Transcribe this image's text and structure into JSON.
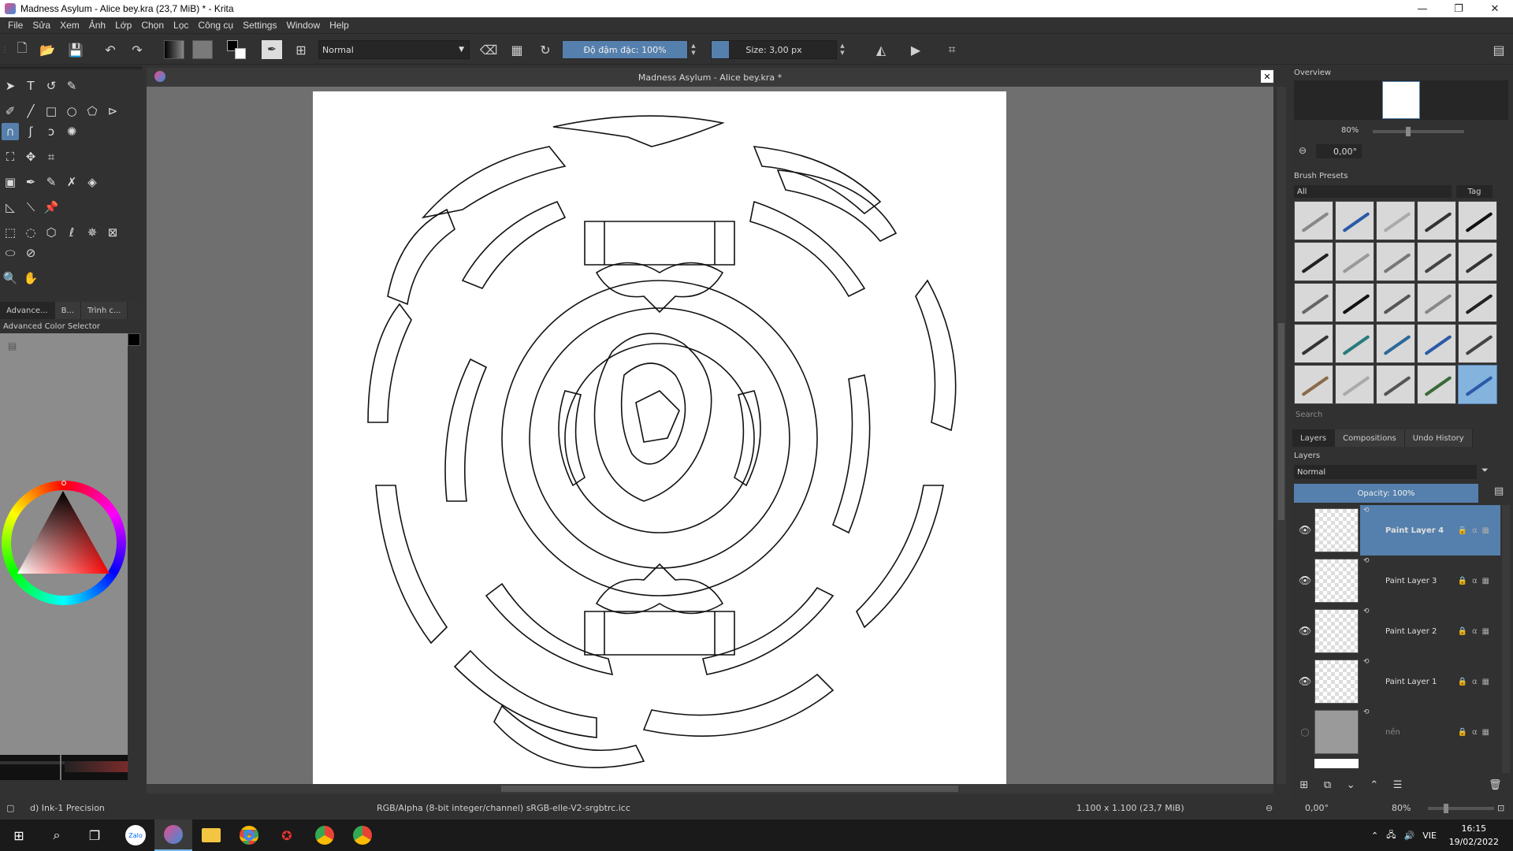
{
  "window": {
    "title": "Madness Asylum - Alice bey.kra (23,7 MiB)  * - Krita",
    "minimize": "—",
    "maximize": "❐",
    "close": "✕"
  },
  "menu": [
    "File",
    "Sửa",
    "Xem",
    "Ảnh",
    "Lớp",
    "Chọn",
    "Lọc",
    "Công cụ",
    "Settings",
    "Window",
    "Help"
  ],
  "toolbar": {
    "blend_mode": "Normal",
    "opacity_label": "Độ đậm đặc: 100%",
    "size_label": "Size: 3,00 px"
  },
  "left_dock": {
    "tabs": [
      "Advance...",
      "B...",
      "Trình c..."
    ],
    "color_selector_title": "Advanced Color Selector",
    "fg_color": "#000000"
  },
  "canvas": {
    "title": "Madness Asylum - Alice bey.kra *",
    "close": "✕"
  },
  "overview": {
    "title": "Overview",
    "zoom": "80%",
    "rotation": "0,00°"
  },
  "brush_presets": {
    "title": "Brush Presets",
    "filter": "All",
    "tag_label": "Tag",
    "search_placeholder": "Search",
    "selected_index": 24
  },
  "layers_docker": {
    "tabs": [
      "Layers",
      "Compositions",
      "Undo History"
    ],
    "title": "Layers",
    "blend_mode": "Normal",
    "opacity_label": "Opacity:  100%",
    "layers": [
      {
        "name": "Paint Layer 4",
        "visible": true,
        "selected": true
      },
      {
        "name": "Paint Layer 3",
        "visible": true,
        "selected": false
      },
      {
        "name": "Paint Layer 2",
        "visible": true,
        "selected": false
      },
      {
        "name": "Paint Layer 1",
        "visible": true,
        "selected": false
      },
      {
        "name": "nền",
        "visible": false,
        "selected": false
      }
    ]
  },
  "status": {
    "brush": "d) Ink-1 Precision",
    "color_space": "RGB/Alpha (8-bit integer/channel)  sRGB-elle-V2-srgbtrc.icc",
    "dimensions": "1.100 x 1.100 (23,7 MiB)",
    "rotation": "0,00°",
    "zoom": "80%"
  },
  "taskbar": {
    "language": "VIE",
    "time": "16:15",
    "date": "19/02/2022"
  },
  "colors": {
    "accent": "#5580ad",
    "panel": "#313131",
    "canvas_bg": "#6f6f6f"
  }
}
